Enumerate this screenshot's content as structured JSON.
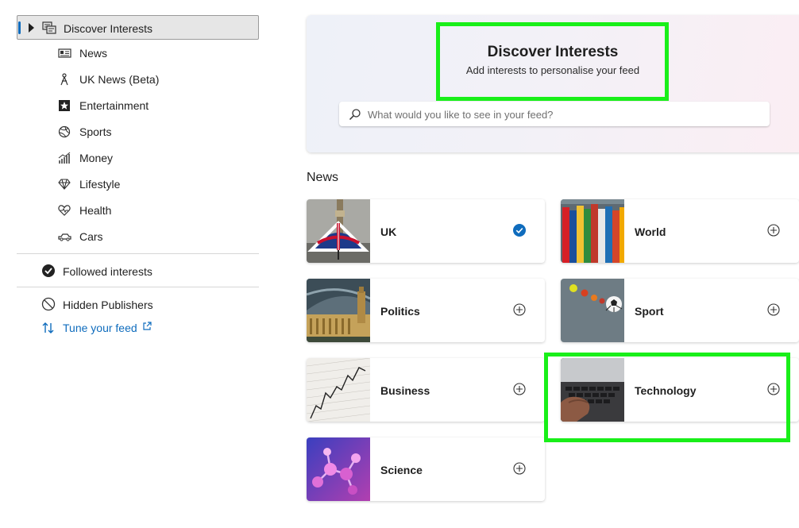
{
  "sidebar": {
    "root": {
      "label": "Discover Interests",
      "icon": "discover-icon"
    },
    "items": [
      {
        "label": "News",
        "icon": "newspaper-icon"
      },
      {
        "label": "UK News (Beta)",
        "icon": "person-pin-icon"
      },
      {
        "label": "Entertainment",
        "icon": "star-icon"
      },
      {
        "label": "Sports",
        "icon": "ball-icon"
      },
      {
        "label": "Money",
        "icon": "chart-icon"
      },
      {
        "label": "Lifestyle",
        "icon": "diamond-icon"
      },
      {
        "label": "Health",
        "icon": "heart-pulse-icon"
      },
      {
        "label": "Cars",
        "icon": "car-icon"
      }
    ],
    "followed": {
      "label": "Followed interests",
      "icon": "check-circle-icon"
    },
    "hidden": {
      "label": "Hidden Publishers",
      "icon": "blocked-icon"
    },
    "tune": {
      "label": "Tune your feed",
      "icon": "sort-arrows-icon",
      "external_icon": "external-link-icon"
    }
  },
  "hero": {
    "title": "Discover Interests",
    "subtitle": "Add interests to personalise your feed",
    "search_placeholder": "What would you like to see in your feed?"
  },
  "section": {
    "title": "News"
  },
  "cards": [
    {
      "name": "UK",
      "followed": true
    },
    {
      "name": "World",
      "followed": false
    },
    {
      "name": "Politics",
      "followed": false
    },
    {
      "name": "Sport",
      "followed": false
    },
    {
      "name": "Business",
      "followed": false
    },
    {
      "name": "Technology",
      "followed": false
    },
    {
      "name": "Science",
      "followed": false
    }
  ],
  "colors": {
    "accent": "#0f6cbd",
    "highlight": "#19ef19"
  }
}
